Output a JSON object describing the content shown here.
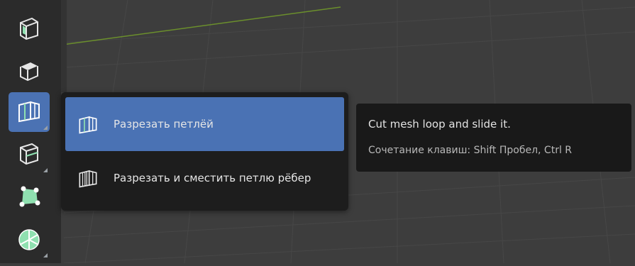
{
  "toolbar": {
    "tools": [
      {
        "icon": "inset-faces-icon",
        "active": false,
        "has_submenu": false
      },
      {
        "icon": "extrude-region-icon",
        "active": false,
        "has_submenu": false
      },
      {
        "icon": "loop-cut-icon",
        "active": true,
        "has_submenu": true
      },
      {
        "icon": "knife-icon",
        "active": false,
        "has_submenu": true
      },
      {
        "icon": "poly-build-icon",
        "active": false,
        "has_submenu": false
      },
      {
        "icon": "spin-icon",
        "active": false,
        "has_submenu": true
      }
    ]
  },
  "menu": {
    "items": [
      {
        "label": "Разрезать петлёй",
        "icon": "loop-cut-icon",
        "active": true
      },
      {
        "label": "Разрезать и сместить петлю рёбер",
        "icon": "offset-edge-loop-cut-icon",
        "active": false
      }
    ]
  },
  "tooltip": {
    "description": "Cut mesh loop and slide it.",
    "shortcut": "Сочетание клавиш: Shift Пробел, Ctrl R"
  },
  "colors": {
    "accent": "#4a72b4",
    "menu_bg": "#1d1d1d",
    "viewport_bg": "#3d3d3d",
    "tool_icon": "#8fe0b0"
  }
}
